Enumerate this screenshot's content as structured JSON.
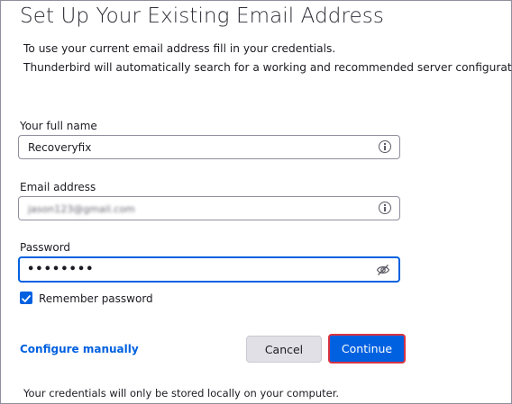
{
  "heading": "Set Up Your Existing Email Address",
  "description": {
    "line1": "To use your current email address fill in your credentials.",
    "line2": "Thunderbird will automatically search for a working and recommended server configuration."
  },
  "fields": {
    "full_name": {
      "label": "Your full name",
      "value": "Recoveryfix",
      "icon": "info-icon"
    },
    "email": {
      "label": "Email address",
      "value": "jason123@gmail.com",
      "icon": "info-icon"
    },
    "password": {
      "label": "Password",
      "value": "••••••••",
      "icon": "eye-slash-icon"
    }
  },
  "remember": {
    "label": "Remember password",
    "checked": true
  },
  "actions": {
    "configure_manually": "Configure manually",
    "cancel": "Cancel",
    "continue": "Continue"
  },
  "footnote": "Your credentials will only be stored locally on your computer.",
  "colors": {
    "accent": "#0061e0",
    "continue_outline": "#d93341"
  }
}
